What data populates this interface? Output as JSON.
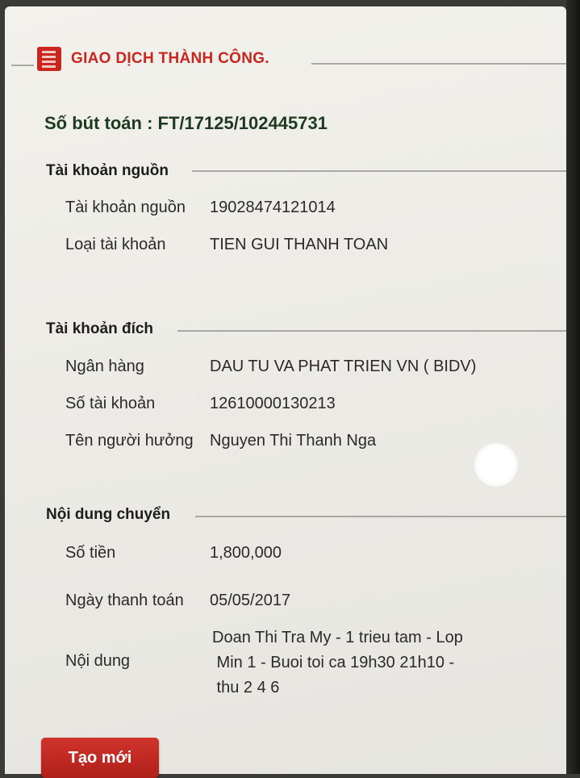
{
  "header": {
    "title": "GIAO DỊCH THÀNH CÔNG.",
    "icon": "list-icon",
    "accent_color": "#c8261f"
  },
  "reference": {
    "text": "Số bút toán : FT/17125/102445731"
  },
  "source_account": {
    "section_title": "Tài khoản nguồn",
    "rows": [
      {
        "label": "Tài khoản nguồn",
        "value": "19028474121014"
      },
      {
        "label": "Loại tài khoản",
        "value": "TIEN GUI THANH TOAN"
      }
    ]
  },
  "destination_account": {
    "section_title": "Tài khoản đích",
    "rows": [
      {
        "label": "Ngân hàng",
        "value": "DAU TU VA PHAT TRIEN VN ( BIDV)"
      },
      {
        "label": "Số tài khoản",
        "value": "12610000130213"
      },
      {
        "label": "Tên người hưởng",
        "value": "Nguyen Thi Thanh Nga"
      }
    ]
  },
  "transfer_content": {
    "section_title": "Nội dung chuyển",
    "rows": [
      {
        "label": "Số tiền",
        "value": "1,800,000"
      },
      {
        "label": "Ngày thanh toán",
        "value": "05/05/2017"
      },
      {
        "label": "Nội dung",
        "value_lines": [
          "Doan Thi Tra My - 1 trieu tam - Lop",
          " Min 1 - Buoi toi ca 19h30 21h10 -",
          " thu 2 4 6"
        ]
      }
    ]
  },
  "actions": {
    "new_button_label": "Tạo mới",
    "button_color": "#c8261f"
  }
}
